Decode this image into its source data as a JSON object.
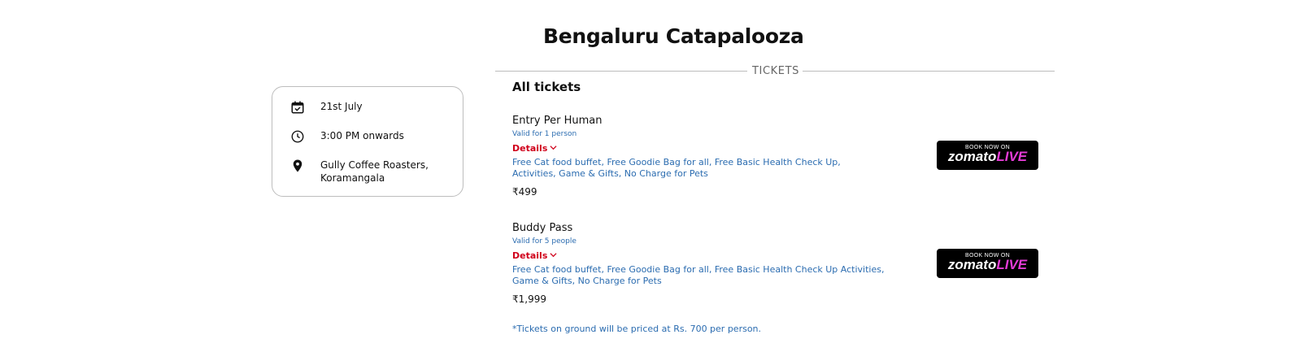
{
  "event": {
    "title": "Bengaluru Catapalooza"
  },
  "info": {
    "date": "21st July",
    "time": "3:00 PM onwards",
    "venue": "Gully Coffee Roasters, Koramangala",
    "icons": [
      "calendar-check-icon",
      "clock-icon",
      "location-pin-icon"
    ]
  },
  "tickets": {
    "section_label": "TICKETS",
    "heading": "All tickets",
    "items": [
      {
        "name": "Entry Per Human",
        "validity": "Valid for 1 person",
        "details_label": "Details",
        "description": "Free Cat food buffet, Free Goodie Bag for all, Free Basic Health Check Up, Activities, Game & Gifts, No Charge for Pets",
        "price": "₹499",
        "book_small": "BOOK NOW ON",
        "book_brand_a": "zomato",
        "book_brand_b": "LIVE"
      },
      {
        "name": "Buddy Pass",
        "validity": "Valid for 5 people",
        "details_label": "Details",
        "description": "Free Cat food buffet, Free Goodie Bag for all, Free Basic Health Check Up Activities, Game & Gifts, No Charge for Pets",
        "price": "₹1,999",
        "book_small": "BOOK NOW ON",
        "book_brand_a": "zomato",
        "book_brand_b": "LIVE"
      }
    ],
    "footnote": "*Tickets on ground will be priced at Rs. 700 per person."
  },
  "colors": {
    "link_blue": "#2b6cb0",
    "details_red": "#d0021b",
    "brand_pink": "#e53cd6",
    "border_gray": "#bdbdbd"
  }
}
